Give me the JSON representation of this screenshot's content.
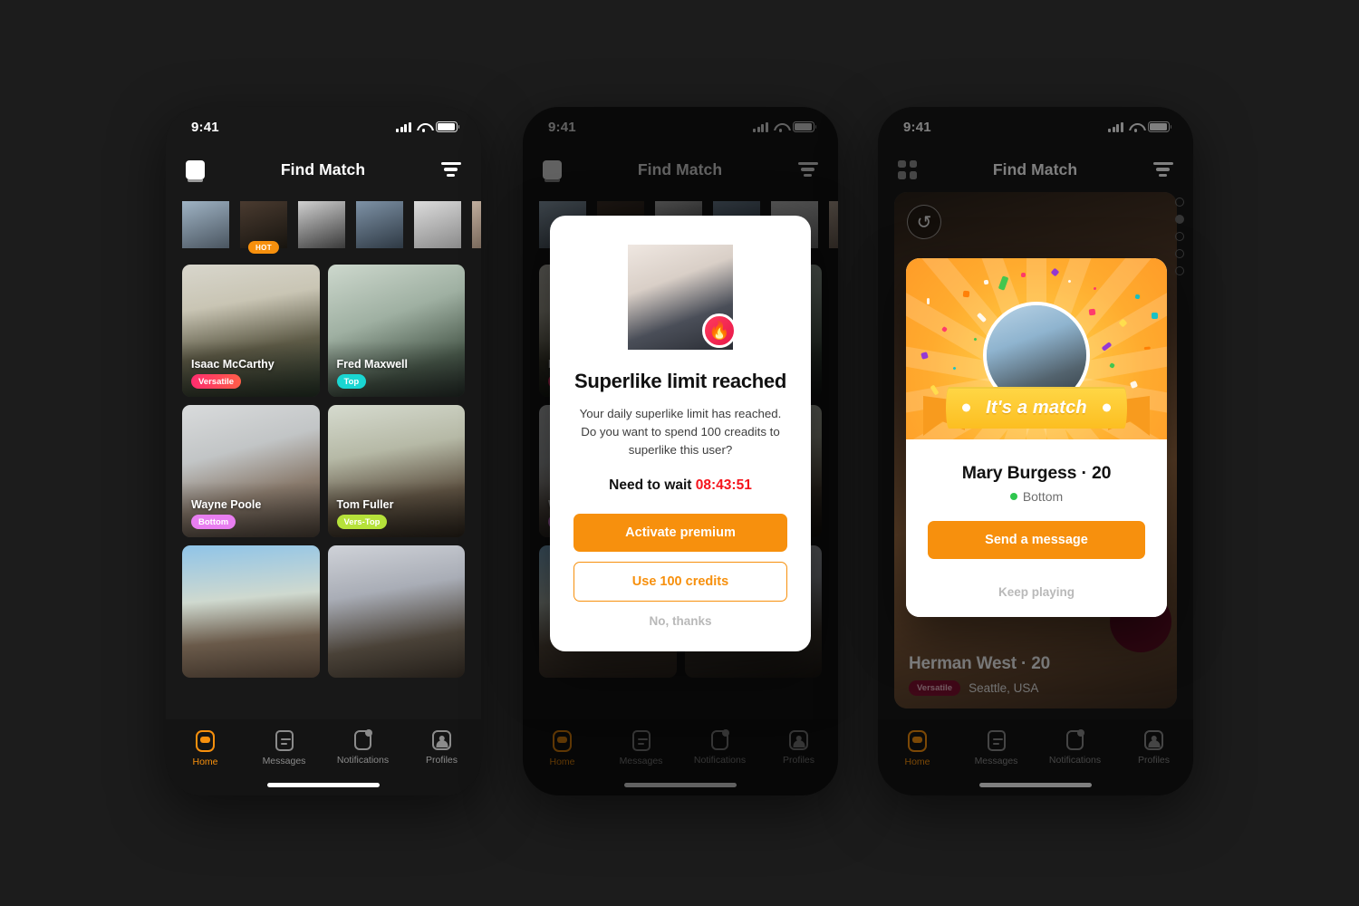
{
  "status_bar": {
    "time": "9:41",
    "signal_icon": "cellular-signal-icon",
    "wifi_icon": "wifi-icon",
    "battery_icon": "battery-icon"
  },
  "header": {
    "title": "Find Match",
    "left_icon_phone1": "app-logo-icon",
    "left_icon_phone3": "grid-view-icon",
    "right_icon": "filter-icon"
  },
  "stories": {
    "items": [
      {
        "name": "story-1",
        "badge": ""
      },
      {
        "name": "story-2",
        "badge": "HOT"
      },
      {
        "name": "story-3",
        "badge": ""
      },
      {
        "name": "story-4",
        "badge": ""
      },
      {
        "name": "story-5",
        "badge": ""
      },
      {
        "name": "story-6",
        "badge": ""
      }
    ]
  },
  "grid": {
    "cards": [
      {
        "name": "Isaac McCarthy",
        "tag": "Versatile",
        "tag_color": "#ff2d6f"
      },
      {
        "name": "Fred Maxwell",
        "tag": "Top",
        "tag_color": "#1ad6d2"
      },
      {
        "name": "Wayne Poole",
        "tag": "Bottom",
        "tag_color": "#e87ef0"
      },
      {
        "name": "Tom Fuller",
        "tag": "Vers-Top",
        "tag_color": "#b6e23a"
      },
      {
        "name": "",
        "tag": "",
        "tag_color": ""
      },
      {
        "name": "",
        "tag": "",
        "tag_color": ""
      }
    ]
  },
  "tabbar": {
    "items": [
      {
        "label": "Home",
        "icon": "home-icon",
        "active": true
      },
      {
        "label": "Messages",
        "icon": "messages-icon",
        "active": false
      },
      {
        "label": "Notifications",
        "icon": "notifications-icon",
        "active": false
      },
      {
        "label": "Profiles",
        "icon": "profile-icon",
        "active": false
      }
    ],
    "active_color": "#f7900d",
    "inactive_color": "#8b8b8b"
  },
  "superlike_modal": {
    "avatar": "user-avatar",
    "badge_icon": "flame-icon",
    "title": "Superlike limit reached",
    "body": "Your daily superlike limit has reached. Do you want to spend 100 creadits to superlike this user?",
    "wait_label": "Need to wait",
    "wait_time": "08:43:51",
    "wait_time_color": "#f5131b",
    "primary_button": "Activate premium",
    "secondary_button": "Use 100 credits",
    "dismiss_button": "No, thanks"
  },
  "swipe_deck": {
    "undo_icon": "undo-rewind-icon",
    "pager_total": 5,
    "pager_active": 2,
    "profile_name": "Herman West",
    "profile_age": "20",
    "separator": "·",
    "tag": "Versatile",
    "location": "Seattle, USA",
    "like_button": "like-heart-button"
  },
  "match_card": {
    "ribbon_text": "It's a match",
    "name": "Mary Burgess",
    "separator": "·",
    "age": "20",
    "role": "Bottom",
    "role_dot_color": "#2fc64e",
    "primary_button": "Send a message",
    "ghost_button": "Keep playing"
  },
  "theme": {
    "accent": "#f7900d",
    "background": "#1c1c1c",
    "screen_bg": "#181818",
    "card_white": "#ffffff"
  }
}
